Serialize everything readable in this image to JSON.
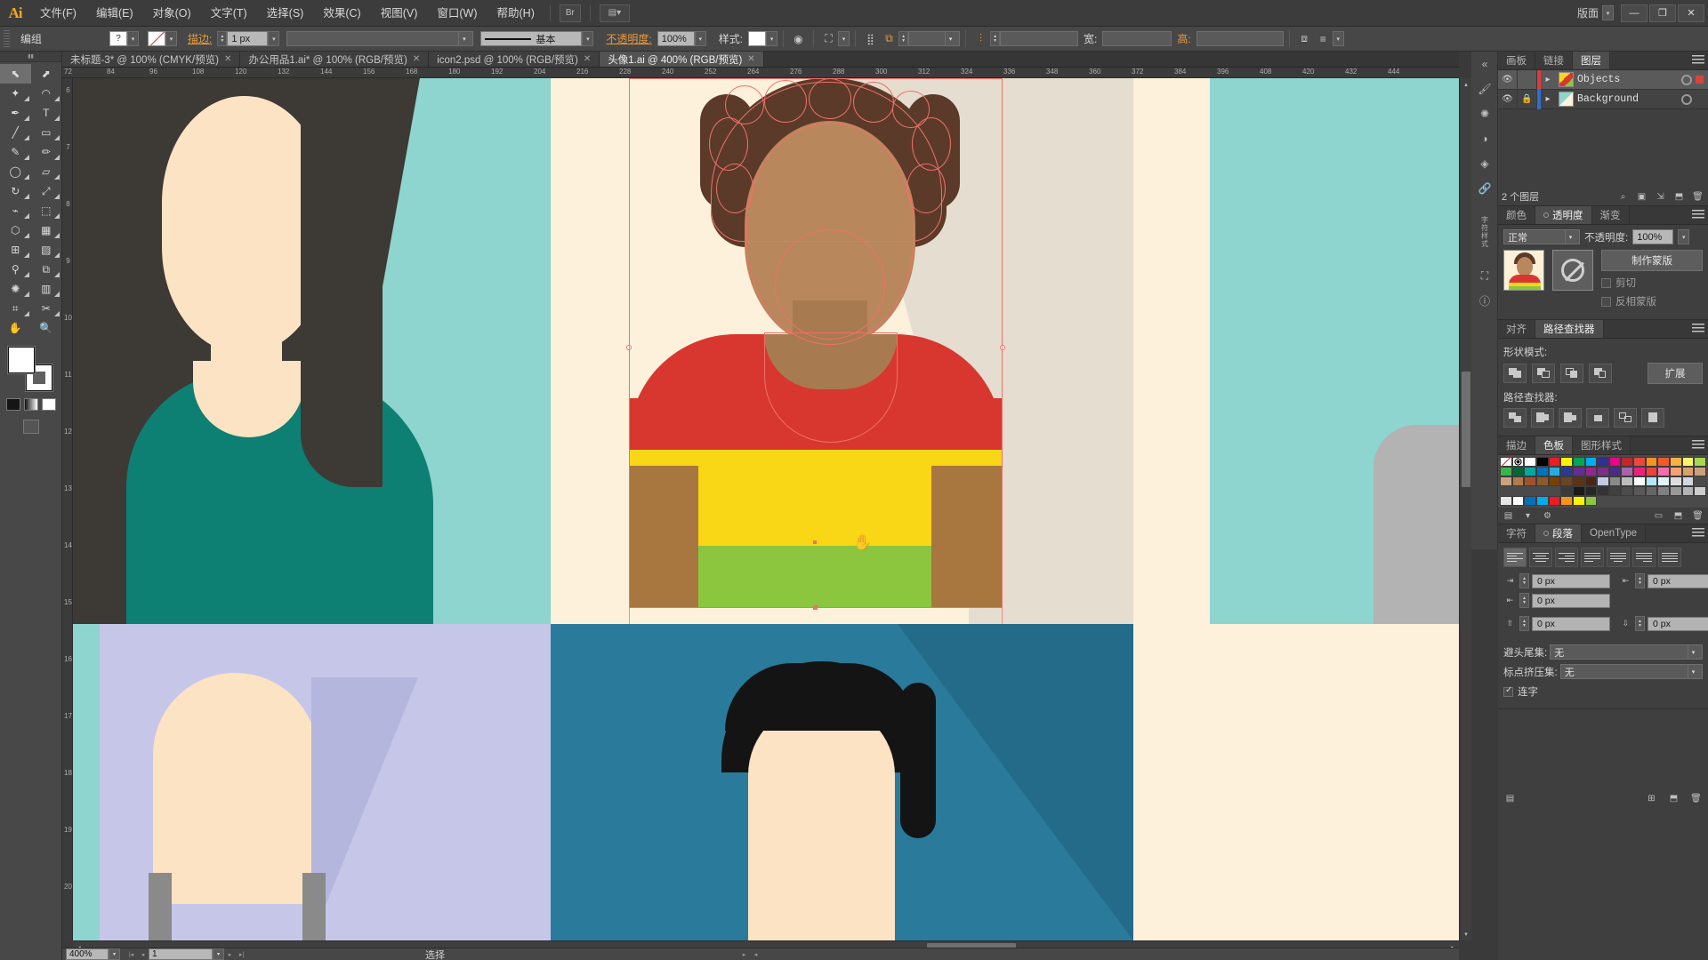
{
  "app": {
    "name": "Ai",
    "logo_text": "Ai"
  },
  "menubar": {
    "items": [
      {
        "label": "文件(F)"
      },
      {
        "label": "编辑(E)"
      },
      {
        "label": "对象(O)"
      },
      {
        "label": "文字(T)"
      },
      {
        "label": "选择(S)"
      },
      {
        "label": "效果(C)"
      },
      {
        "label": "视图(V)"
      },
      {
        "label": "窗口(W)"
      },
      {
        "label": "帮助(H)"
      }
    ],
    "workspace_label": "版面",
    "window_buttons": {
      "minimize": "—",
      "restore": "❐",
      "close": "✕"
    }
  },
  "optionsbar": {
    "selection_label": "编组",
    "fill_swatch_glyph": "?",
    "stroke_label": "描边:",
    "stroke_weight": "1 px",
    "stroke_profile_placeholder": "",
    "brush_label": "基本",
    "opacity_label": "不透明度:",
    "opacity_value": "100%",
    "style_label": "样式:",
    "transform_label": "",
    "align_value_1": "",
    "align_value_2": "",
    "width_label": "宽:",
    "height_label": "高:"
  },
  "tabs": [
    {
      "label": "未标题-3* @ 100% (CMYK/预览)",
      "active": false,
      "closeable": true
    },
    {
      "label": "办公用品1.ai* @ 100% (RGB/预览)",
      "active": false,
      "closeable": true
    },
    {
      "label": "icon2.psd @ 100% (RGB/预览)",
      "active": false,
      "closeable": true
    },
    {
      "label": "头像1.ai @ 400% (RGB/预览)",
      "active": true,
      "closeable": true
    }
  ],
  "ruler": {
    "horizontal_ticks": [
      "72",
      "84",
      "96",
      "108",
      "120",
      "132",
      "144",
      "156",
      "168",
      "180",
      "192",
      "204",
      "216",
      "228",
      "240",
      "252",
      "264",
      "276",
      "288",
      "300",
      "312",
      "324",
      "336",
      "348",
      "360",
      "372",
      "384",
      "396",
      "408",
      "420",
      "432",
      "444"
    ],
    "vertical_ticks": [
      "6",
      "7",
      "8",
      "9",
      "10",
      "11",
      "12",
      "13",
      "14",
      "15",
      "16",
      "17",
      "18",
      "19",
      "20"
    ]
  },
  "toolbox": {
    "tools": [
      {
        "name": "selection-tool",
        "glyph": "⬉",
        "selected": true
      },
      {
        "name": "direct-selection-tool",
        "glyph": "⬈",
        "selected": false
      },
      {
        "name": "magic-wand-tool",
        "glyph": "✦",
        "selected": false
      },
      {
        "name": "lasso-tool",
        "glyph": "◠",
        "selected": false
      },
      {
        "name": "pen-tool",
        "glyph": "✒",
        "selected": false
      },
      {
        "name": "type-tool",
        "glyph": "T",
        "selected": false
      },
      {
        "name": "line-segment-tool",
        "glyph": "╱",
        "selected": false
      },
      {
        "name": "rectangle-tool",
        "glyph": "▭",
        "selected": false
      },
      {
        "name": "paintbrush-tool",
        "glyph": "🖌",
        "selected": false
      },
      {
        "name": "pencil-tool",
        "glyph": "✎",
        "selected": false
      },
      {
        "name": "blob-brush-tool",
        "glyph": "●",
        "selected": false
      },
      {
        "name": "eraser-tool",
        "glyph": "▱",
        "selected": false
      },
      {
        "name": "rotate-tool",
        "glyph": "↻",
        "selected": false
      },
      {
        "name": "scale-tool",
        "glyph": "⤢",
        "selected": false
      },
      {
        "name": "width-tool",
        "glyph": "⌁",
        "selected": false
      },
      {
        "name": "free-transform-tool",
        "glyph": "⬚",
        "selected": false
      },
      {
        "name": "shape-builder-tool",
        "glyph": "⬡",
        "selected": false
      },
      {
        "name": "perspective-grid-tool",
        "glyph": "▦",
        "selected": false
      },
      {
        "name": "mesh-tool",
        "glyph": "⊞",
        "selected": false
      },
      {
        "name": "gradient-tool",
        "glyph": "▨",
        "selected": false
      },
      {
        "name": "eyedropper-tool",
        "glyph": "⚲",
        "selected": false
      },
      {
        "name": "blend-tool",
        "glyph": "⧉",
        "selected": false
      },
      {
        "name": "symbol-sprayer-tool",
        "glyph": "✺",
        "selected": false
      },
      {
        "name": "column-graph-tool",
        "glyph": "▥",
        "selected": false
      },
      {
        "name": "artboard-tool",
        "glyph": "⌗",
        "selected": false
      },
      {
        "name": "slice-tool",
        "glyph": "✂",
        "selected": false
      },
      {
        "name": "hand-tool",
        "glyph": "✋",
        "selected": false
      },
      {
        "name": "zoom-tool",
        "glyph": "🔍",
        "selected": false
      }
    ],
    "fill_color": "#ffffff",
    "stroke_color": "#ffffff"
  },
  "panels": {
    "layers": {
      "tabs": [
        {
          "label": "画板",
          "active": false
        },
        {
          "label": "链接",
          "active": false
        },
        {
          "label": "图层",
          "active": true
        }
      ],
      "rows": [
        {
          "name": "Objects",
          "visible": true,
          "locked": false,
          "selected": true,
          "color": "#e03a3a"
        },
        {
          "name": "Background",
          "visible": true,
          "locked": true,
          "selected": false,
          "color": "#2f6fd0"
        }
      ],
      "count_label": "2 个图层"
    },
    "transparency": {
      "tabs": [
        {
          "label": "颜色",
          "active": false
        },
        {
          "label": "透明度",
          "active": true
        },
        {
          "label": "渐变",
          "active": false
        }
      ],
      "blend_mode": "正常",
      "opacity_label": "不透明度:",
      "opacity_value": "100%",
      "make_mask_button": "制作蒙版",
      "clip_label": "剪切",
      "invert_mask_label": "反相蒙版",
      "clip_checked": false,
      "invert_checked": false
    },
    "pathfinder": {
      "tabs": [
        {
          "label": "对齐",
          "active": false
        },
        {
          "label": "路径查找器",
          "active": true
        }
      ],
      "shape_modes_label": "形状模式:",
      "expand_button": "扩展",
      "pathfinders_label": "路径查找器:",
      "shape_mode_buttons": [
        "unite",
        "minus-front",
        "intersect",
        "exclude"
      ],
      "pathfinder_buttons": [
        "divide",
        "trim",
        "merge",
        "crop",
        "outline",
        "minus-back"
      ]
    },
    "swatches": {
      "tabs": [
        {
          "label": "描边",
          "active": false
        },
        {
          "label": "色板",
          "active": true
        },
        {
          "label": "图形样式",
          "active": false
        }
      ],
      "rows": [
        [
          "none",
          "registration",
          "#ffffff",
          "#000000",
          "#ed1c24",
          "#fff200",
          "#00a651",
          "#00aeef",
          "#2e3192",
          "#ec008c",
          "#c1272d",
          "#e8493c",
          "#f7941e",
          "#f15a29"
        ],
        [
          "#fbb040",
          "#fff568",
          "#a7d84f",
          "#39b54a",
          "#006838",
          "#00a99d",
          "#0071bc",
          "#29abe2",
          "#2b3990",
          "#662d91",
          "#92278f",
          "#7b2e8a",
          "#4c2a85",
          "#a864a8"
        ],
        [
          "#ed217c",
          "#ef4136",
          "#f06eaa",
          "#f9a072",
          "#d9a06b",
          "#c8a27a",
          "#caa37e",
          "#b07c4a",
          "#a0522d",
          "#8b5a2b",
          "#7b3f00",
          "#6b4423",
          "#5c3317",
          "#4a2511"
        ],
        [
          "#c5cae9",
          "#8a8a8a",
          "#bdbdbd",
          "#ffffff",
          "#b3e5fc",
          "#e0f7fa",
          "#dcdcdc",
          "#cfd8dc",
          "",
          "",
          "",
          "",
          "",
          ""
        ],
        [
          "#3a3a3a",
          "#1a1a1a",
          "#262626",
          "#333333",
          "#404040",
          "#4d4d4d",
          "#595959",
          "#666666",
          "#808080",
          "#999999",
          "#b3b3b3",
          "#cccccc",
          "#e6e6e6",
          "#ffffff"
        ],
        [
          "#0071bc",
          "#00aeef",
          "#ed1c24",
          "#f7941e",
          "#fff200",
          "#8dc63f",
          "",
          "",
          "",
          "",
          "",
          "",
          "",
          ""
        ]
      ]
    },
    "paragraph": {
      "tabs": [
        {
          "label": "字符",
          "active": false
        },
        {
          "label": "段落",
          "active": true
        },
        {
          "label": "OpenType",
          "active": false
        }
      ],
      "align_buttons": [
        "align-left",
        "align-center",
        "align-right",
        "justify-last-left",
        "justify-last-center",
        "justify-last-right",
        "justify-all"
      ],
      "active_align_index": 0,
      "left_indent": "0 px",
      "right_indent": "0 px",
      "first_line_indent": "0 px",
      "space_before": "0 px",
      "space_after": "0 px",
      "kinsoku_label": "避头尾集:",
      "kinsoku_value": "无",
      "mojikumi_label": "标点挤压集:",
      "mojikumi_value": "无",
      "hyphenate_label": "连字",
      "hyphenate_checked": true
    }
  },
  "statusbar": {
    "zoom": "400%",
    "page": "1",
    "status_text": "选择"
  },
  "canvas": {
    "zoom_percent": "400%",
    "artwork_colors": {
      "teal_bg": "#8ed4cf",
      "dark_hair": "#3d3935",
      "teal_shirt": "#0e7f73",
      "skin_light": "#fbe3c3",
      "cream_bg": "#fdf1dc",
      "skin_dark": "#b8875c",
      "hair_brown": "#5b3a29",
      "red_shirt": "#d8372f",
      "yellow": "#f9d616",
      "green": "#8cc63f",
      "brown_arm": "#a8763f",
      "lavender_bg": "#c6c7e8",
      "blue_bg": "#2a7a9b",
      "black_hair": "#141414",
      "gray_panel": "#bdbdbd",
      "shadow_cream": "#e5ddd0",
      "selection_pink": "#f0706a"
    }
  }
}
